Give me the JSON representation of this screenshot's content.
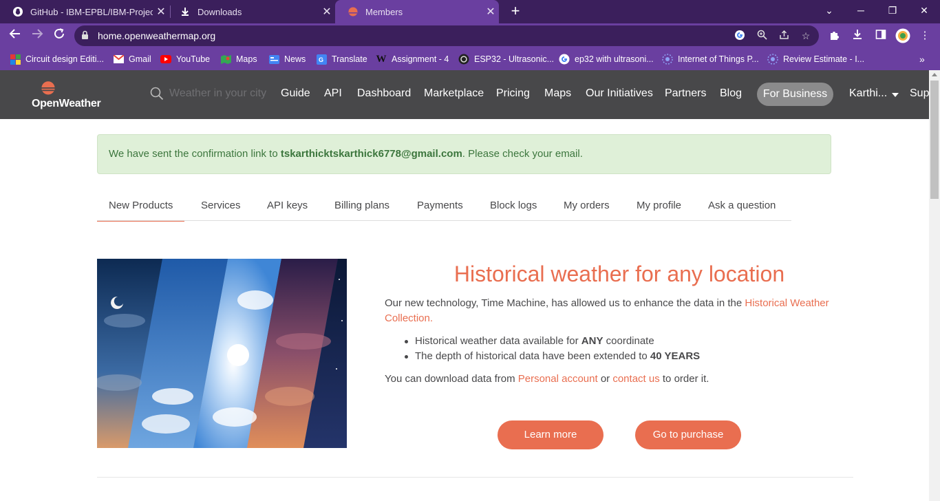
{
  "browser": {
    "tabs": [
      {
        "title": "GitHub - IBM-EPBL/IBM-Project-",
        "icon": "github-icon"
      },
      {
        "title": "Downloads",
        "icon": "download-icon"
      },
      {
        "title": "Members",
        "icon": "openweather-icon"
      }
    ],
    "url": "home.openweathermap.org",
    "bookmarks": [
      {
        "label": "Circuit design Editi...",
        "icon": "circuit-icon",
        "color": "#4caf50"
      },
      {
        "label": "Gmail",
        "icon": "gmail-icon",
        "color": "#ea4335"
      },
      {
        "label": "YouTube",
        "icon": "youtube-icon",
        "color": "#ff0000"
      },
      {
        "label": "Maps",
        "icon": "maps-icon",
        "color": "#34a853"
      },
      {
        "label": "News",
        "icon": "news-icon",
        "color": "#4285f4"
      },
      {
        "label": "Translate",
        "icon": "translate-icon",
        "color": "#4285f4"
      },
      {
        "label": "Assignment - 4",
        "icon": "wordpress-icon",
        "color": "#222222"
      },
      {
        "label": "ESP32 - Ultrasonic...",
        "icon": "esp32-icon",
        "color": "#222222"
      },
      {
        "label": "ep32 with ultrasoni...",
        "icon": "google-icon",
        "color": "#ffffff"
      },
      {
        "label": "Internet of Things P...",
        "icon": "ibm-icon",
        "color": "#5b6ee1"
      },
      {
        "label": "Review Estimate - I...",
        "icon": "ibm-icon",
        "color": "#5b6ee1"
      }
    ]
  },
  "site": {
    "logo_text": "OpenWeather",
    "search_placeholder": "Weather in your city",
    "menu": [
      "Guide",
      "API",
      "Dashboard",
      "Marketplace",
      "Pricing",
      "Maps",
      "Our Initiatives",
      "Partners",
      "Blog"
    ],
    "for_business": "For Business",
    "user": "Karthi...",
    "support": "Sup",
    "brand_color": "#e96e50",
    "header_color": "#48484a"
  },
  "alert": {
    "prefix": "We have sent the confirmation link to ",
    "email": "tskarthicktskarthick6778@gmail.com",
    "suffix": ". Please check your email."
  },
  "account_tabs": [
    "New Products",
    "Services",
    "API keys",
    "Billing plans",
    "Payments",
    "Block logs",
    "My orders",
    "My profile",
    "Ask a question"
  ],
  "promo": {
    "title": "Historical weather for any location",
    "desc_prefix": "Our new technology, Time Machine, has allowed us to enhance the data in the ",
    "desc_link": "Historical Weather Collection",
    "desc_suffix": ".",
    "bullet1_prefix": "Historical weather data available for ",
    "bullet1_bold": "ANY",
    "bullet1_suffix": " coordinate",
    "bullet2_prefix": "The depth of historical data have been extended to ",
    "bullet2_bold": "40 YEARS",
    "dl_prefix": "You can download data from ",
    "dl_link1": "Personal account",
    "dl_mid": " or ",
    "dl_link2": "contact us",
    "dl_suffix": " to order it.",
    "learn_more": "Learn more",
    "purchase": "Go to purchase"
  }
}
